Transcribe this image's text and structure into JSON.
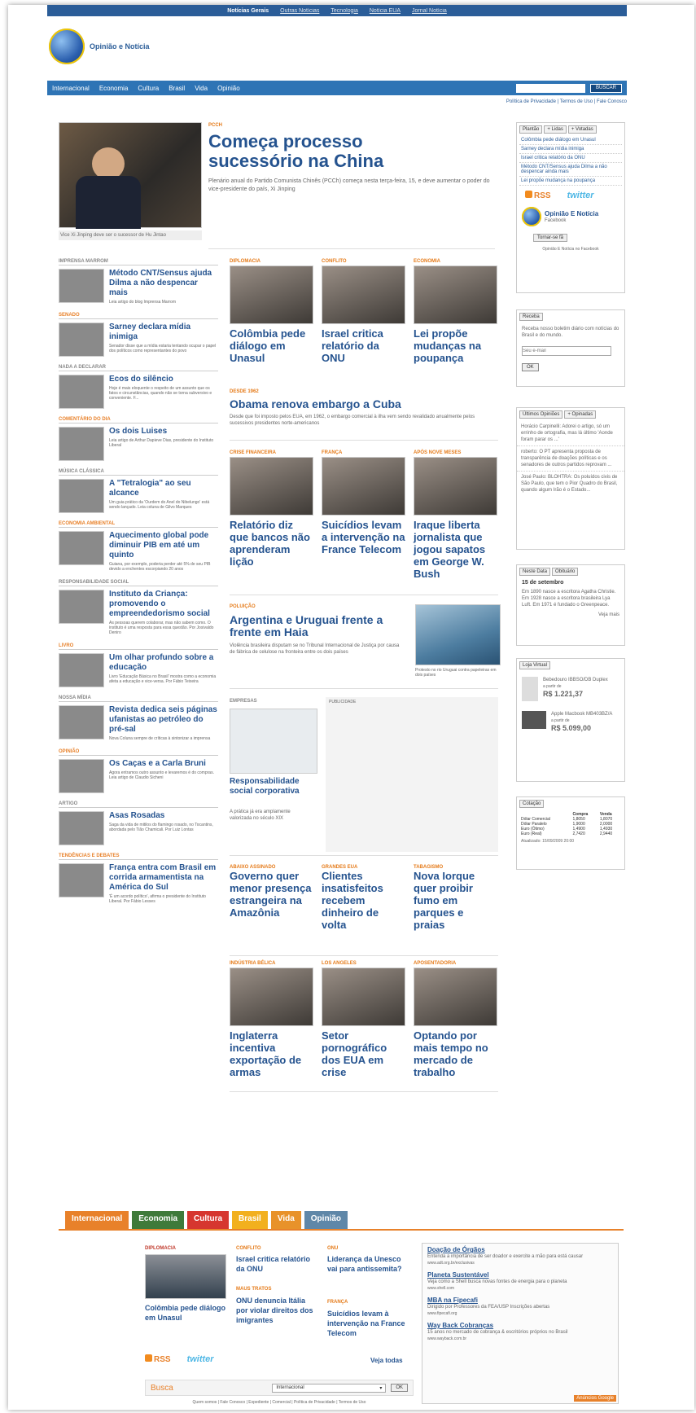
{
  "topbar": {
    "items": [
      "Notícias Gerais",
      "Outras Notícias",
      "Tecnologia",
      "Notícia EUA",
      "Jornal Notícia"
    ]
  },
  "site": {
    "logo_text": "Opinião e Notícia"
  },
  "nav": {
    "items": [
      "Internacional",
      "Economia",
      "Cultura",
      "Brasil",
      "Vida",
      "Opinião"
    ],
    "search_button": "BUSCAR",
    "search_placeholder": ""
  },
  "policy_links": "Política de Privacidade | Termos de Uso | Fale Conosco",
  "lead": {
    "kicker": "PCCh",
    "title": "Começa processo sucessório na China",
    "summary": "Plenário anual do Partido Comunista Chinês (PCCh) começa nesta terça-feira, 15, e deve aumentar o poder do vice-presidente do país, Xi Jinping",
    "caption": "Vice Xi Jinping deve ser o sucessor de Hu Jintao"
  },
  "left_column": [
    {
      "section": "IMPRENSA MARROM",
      "title": "Método CNT/Sensus ajuda Dilma a não despencar mais",
      "text": "Leia artigo do blog Imprensa Marrom"
    },
    {
      "section": "SENADO",
      "title": "Sarney declara mídia inimiga",
      "text": "Senador disse que a mídia estaria tentando ocupar o papel dos políticos como representantes do povo"
    },
    {
      "section": "NADA A DECLARAR",
      "title": "Ecos do silêncio",
      "text": "Hoje é mais eloquente o respeito de um assunto que os fatos e circunstâncias, quando não se torna subversivo e conveniente. F..."
    },
    {
      "section": "COMENTÁRIO DO DIA",
      "title": "Os dois Luises",
      "text": "Leia artigo de Arthur Dapieve Dias, presidente do Instituto Liberal"
    },
    {
      "section": "MÚSICA CLÁSSICA",
      "title": "A \"Tetralogia\" ao seu alcance",
      "text": "Um guia prático da 'Ourdem do Anel do Nibelungo' está sendo lançado. Leia coluna de Gilvo Marques"
    },
    {
      "section": "ECONOMIA AMBIENTAL",
      "title": "Aquecimento global pode diminuir PIB em até um quinto",
      "text": "Guiana, por exemplo, poderia perder até 5% de seu PIB devido a enchentes escorpiando 20 anos"
    },
    {
      "section": "RESPONSABILIDADE SOCIAL",
      "title": "Instituto da Criança: promovendo o empreendedorismo social",
      "text": "As pessoas querem colaborar, mas não sabem como. O instituto é uma resposta para essa questão. Por Josivaldo Deniro"
    },
    {
      "section": "LIVRO",
      "title": "Um olhar profundo sobre a educação",
      "text": "Livro 'Educação Básica no Brasil' mostra como a economia afeta a educação e vice-versa. Por Fábio Teixeira"
    },
    {
      "section": "NOSSA MÍDIA",
      "title": "Revista dedica seis páginas ufanistas ao petróleo do pré-sal",
      "text": "Nova Coluna sempre de críticas à sintonizar a imprensa"
    },
    {
      "section": "OPINIÃO",
      "title": "Os Caças e a Carla Bruni",
      "text": "Agora entramos outro assunto e levaremos é do compras. Leia artigo de Claudio Sicheni"
    },
    {
      "section": "ARTIGO",
      "title": "Asas Rosadas",
      "text": "Saga da vida de mitilos do flamingo rosado, no Tocantins, abordada pelo Tião Chamicali. Por Luiz Lontas"
    },
    {
      "section": "TENDÊNCIAS E DEBATES",
      "title": "França entra com Brasil em corrida armamentista na América do Sul",
      "text": "'É um acordo político', afirma o presidente do Instituto Liberal. Por Fábio Lesses"
    }
  ],
  "center": {
    "row1": [
      {
        "kicker": "DIPLOMACIA",
        "title": "Colômbia pede diálogo em Unasul"
      },
      {
        "kicker": "CONFLITO",
        "title": "Israel critica relatório da ONU"
      },
      {
        "kicker": "ECONOMIA",
        "title": "Lei propõe mudanças na poupança"
      }
    ],
    "cuba": {
      "kicker": "DESDE 1962",
      "title": "Obama renova embargo a Cuba",
      "text": "Desde que foi imposto pelos EUA, em 1962, o embargo comercial à ilha vem sendo revalidado anualmente pelos sucessivos presidentes norte-americanos"
    },
    "row2": [
      {
        "kicker": "CRISE FINANCEIRA",
        "title": "Relatório diz que bancos não aprenderam lição"
      },
      {
        "kicker": "FRANÇA",
        "title": "Suicídios levam a intervenção na France Telecom"
      },
      {
        "kicker": "APÓS NOVE MESES",
        "title": "Iraque liberta jornalista que jogou sapatos em George W. Bush"
      }
    ],
    "haia": {
      "kicker": "POLUIÇÃO",
      "title": "Argentina e Uruguai frente a frente em Haia",
      "text": "Violência brasileira disputam se no Tribunal Internacional de Justiça por causa de fábrica de celulose na fronteira entre os dois países",
      "caption": "Protesto no rio Uruguai contra papeleiras em dois países"
    },
    "empresas": {
      "kicker": "EMPRESAS",
      "title": "Responsabilidade social corporativa",
      "text": "A prática já era amplamente valorizada no século XIX"
    },
    "publicidade": "PUBLICIDADE",
    "row3": [
      {
        "kicker": "ABAIXO ASSINADO",
        "title": "Governo quer menor presença estrangeira na Amazônia"
      },
      {
        "kicker": "GRANDES EUA",
        "title": "Clientes insatisfeitos recebem dinheiro de volta"
      },
      {
        "kicker": "TABAGISMO",
        "title": "Nova Iorque quer proibir fumo em parques e praias"
      }
    ],
    "row4": [
      {
        "kicker": "INDÚSTRIA BÉLICA",
        "title": "Inglaterra incentiva exportação de armas"
      },
      {
        "kicker": "LOS ANGELES",
        "title": "Setor pornográfico dos EUA em crise"
      },
      {
        "kicker": "APOSENTADORIA",
        "title": "Optando por mais tempo no mercado de trabalho"
      }
    ]
  },
  "right": {
    "tabs": [
      "Plantão",
      "+ Lidas",
      "+ Votadas"
    ],
    "list": [
      "Colômbia pede diálogo em Unasul",
      "Sarney declara mídia inimiga",
      "Israel critica relatório da ONU",
      "Método CNT/Sensus ajuda Dilma a não despencar ainda mais",
      "Lei propõe mudança na poupança"
    ],
    "rss": "RSS",
    "twitter": "twitter",
    "fb_title": "Opinião E Notícia",
    "fb_sub": "Facebook",
    "fb_button": "Tornar-se fã",
    "fb_caption": "Opinião E Notícia no Facebook",
    "newsletter": {
      "tab": "Receba",
      "text": "Receba nosso boletim diário com notícias do Brasil e do mundo.",
      "placeholder": "Seu e-mail",
      "button": "OK"
    },
    "comments": {
      "tabs": [
        "Últimos Opiniões",
        "+ Opinadas"
      ],
      "items": [
        "Horácio Carpinelli: Adorei o artigo, só um errinho de ortografia, mas lá último 'Aonde foram parar os ...'",
        "roberto: O PT apresenta proposta de transparência de doações políticas e os senadores de outros partidos reprovam ...",
        "José Paulo: BLOHTRA: Os poluídos civis de São Paulo, que tem o Pior Quadro do Brasil, quando algum Irão é o Estado..."
      ]
    },
    "history": {
      "tabs": [
        "Neste Data",
        "Obituário"
      ],
      "date": "15 de setembro",
      "text": "Em 1890 nasce a escritora Agatha Christie. Em 1928 nasce a escritora brasileira Lya Luft. Em 1971 é fundado o Greenpeace.",
      "more": "Veja mais"
    },
    "store": {
      "tab": "Loja Virtual",
      "items": [
        {
          "name": "Bebedouro IBBSO/DB Duplex",
          "price_label": "a partir de",
          "price": "R$ 1.221,37"
        },
        {
          "name": "Apple Macbook MB403BZ/A",
          "price_label": "a partir de",
          "price": "R$ 5.099,00"
        }
      ]
    },
    "currency": {
      "tab": "Cotação",
      "headers": [
        "",
        "Compra",
        "Venda"
      ],
      "rows": [
        [
          "Dólar Comercial",
          "1,8050",
          "1,8070"
        ],
        [
          "Dólar Paralelo",
          "1,9000",
          "2,0000"
        ],
        [
          "Euro (Ótimo)",
          "1,4900",
          "1,4930"
        ],
        [
          "Euro (Real)",
          "2,7420",
          "2,9440"
        ]
      ],
      "updated": "Atualizado: 15/09/2009 20:00"
    }
  },
  "bottom": {
    "tabs": [
      {
        "label": "Internacional",
        "color": "#e8812a"
      },
      {
        "label": "Economia",
        "color": "#3f7a3a"
      },
      {
        "label": "Cultura",
        "color": "#d6362f"
      },
      {
        "label": "Brasil",
        "color": "#f2b01e"
      },
      {
        "label": "Vida",
        "color": "#e8922a"
      },
      {
        "label": "Opinião",
        "color": "#5f87a8"
      }
    ],
    "items": [
      {
        "kicker": "DIPLOMACIA",
        "title": "Colômbia pede diálogo em Unasul"
      },
      {
        "kicker": "CONFLITO",
        "title": "Israel critica relatório da ONU"
      },
      {
        "kicker": "ONU",
        "title": "Liderança da Unesco vai para antissemita?"
      },
      {
        "kicker": "MAUS TRATOS",
        "title": "ONU denuncia Itália por violar direitos dos imigrantes"
      },
      {
        "kicker": "FRANÇA",
        "title": "Suicídios levam à intervenção na France Telecom"
      }
    ],
    "see_all": "Veja todas",
    "ads": [
      {
        "title": "Doação de Órgãos",
        "text": "Entenda a importância de ser doador e exercite a mão para está causar",
        "url": "www.adt.org.br/exclusivas"
      },
      {
        "title": "Planeta Sustentável",
        "text": "Veja como a Shell busca novas fontes de energia para o planeta",
        "url": "www.shell.com"
      },
      {
        "title": "MBA na Fipecafi",
        "text": "Dirigido por Professores da FEA/USP Inscrições abertas",
        "url": "www.fipecafi.org"
      },
      {
        "title": "Way Back Cobranças",
        "text": "15 anos no mercado de cobrança & escritórios próprios no Brasil",
        "url": "www.wayback.com.br"
      }
    ],
    "ads_label": "Anúncios Google",
    "busca_label": "Busca",
    "busca_select": "Internacional",
    "busca_button": "OK",
    "footer": "Quem somos | Fale Conosco | Expediente | Comercial | Política de Privacidade | Termos de Uso"
  }
}
